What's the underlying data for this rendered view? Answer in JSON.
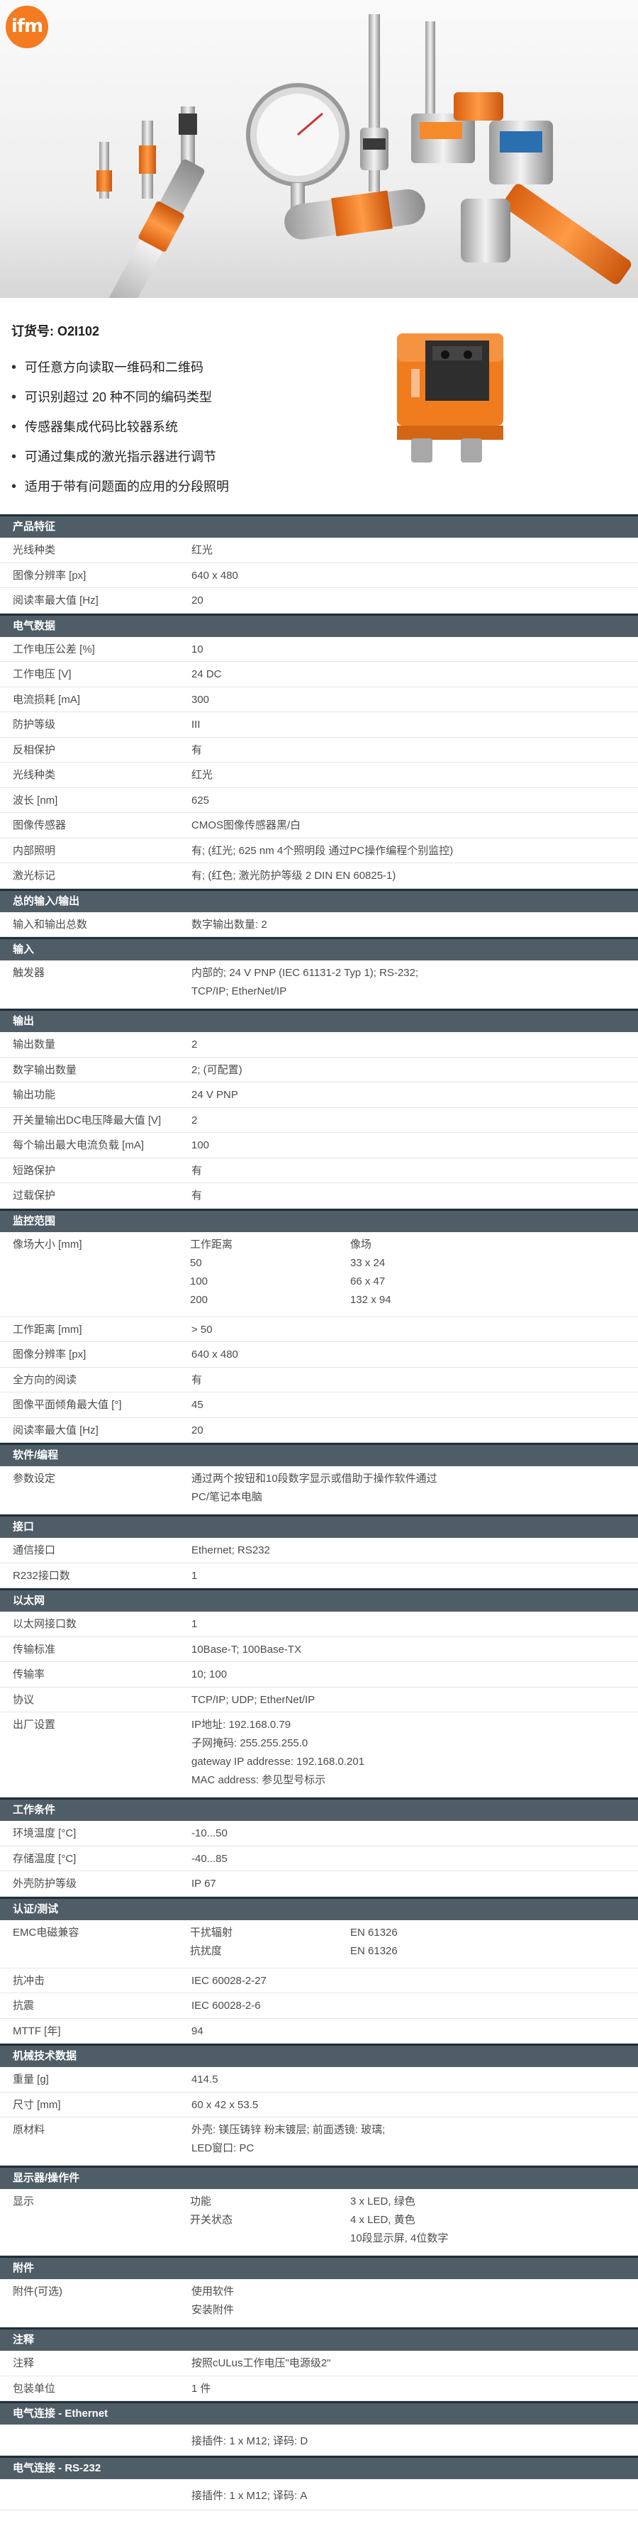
{
  "logo": {
    "text": "ifm"
  },
  "order": {
    "label": "订货号: O2I102"
  },
  "bullets": [
    "可任意方向读取一维码和二维码",
    "可识别超过 20 种不同的编码类型",
    "传感器集成代码比较器系统",
    "可通过集成的激光指示器进行调节",
    "适用于带有问题面的应用的分段照明"
  ],
  "colors": {
    "brand": "#f47b20",
    "section_header": "#4f5d66",
    "section_border": "#1f2f3a"
  },
  "sections": {
    "product": {
      "title": "产品特征",
      "rows": [
        {
          "k": "光线种类",
          "v": "红光"
        },
        {
          "k": "图像分辨率 [px]",
          "v": "640 x 480"
        },
        {
          "k": "阅读率最大值 [Hz]",
          "v": "20"
        }
      ]
    },
    "electrical": {
      "title": "电气数据",
      "rows": [
        {
          "k": "工作电压公差 [%]",
          "v": "10"
        },
        {
          "k": "工作电压 [V]",
          "v": "24 DC"
        },
        {
          "k": "电流损耗 [mA]",
          "v": "300"
        },
        {
          "k": "防护等级",
          "v": "III"
        },
        {
          "k": "反相保护",
          "v": "有"
        },
        {
          "k": "光线种类",
          "v": "红光"
        },
        {
          "k": "波长 [nm]",
          "v": "625"
        },
        {
          "k": "图像传感器",
          "v": "CMOS图像传感器黑/白"
        },
        {
          "k": "内部照明",
          "v": "有; (红光; 625 nm 4个照明段 通过PC操作编程个别监控)"
        },
        {
          "k": "激光标记",
          "v": "有; (红色; 激光防护等级 2 DIN EN 60825-1)"
        }
      ]
    },
    "io_total": {
      "title": "总的输入/输出",
      "rows": [
        {
          "k": "输入和输出总数",
          "v": "数字输出数量: 2"
        }
      ]
    },
    "inputs": {
      "title": "输入",
      "rows": [
        {
          "k": "触发器",
          "v1": "内部的; 24 V PNP (IEC 61131-2 Typ 1); RS-232;",
          "v2": "TCP/IP; EtherNet/IP"
        }
      ]
    },
    "outputs": {
      "title": "输出",
      "rows": [
        {
          "k": "输出数量",
          "v": "2"
        },
        {
          "k": "数字输出数量",
          "v": "2; (可配置)"
        },
        {
          "k": "输出功能",
          "v": "24 V PNP"
        },
        {
          "k": "开关量输出DC电压降最大值 [V]",
          "v": "2"
        },
        {
          "k": "每个输出最大电流负载 [mA]",
          "v": "100"
        },
        {
          "k": "短路保护",
          "v": "有"
        },
        {
          "k": "过载保护",
          "v": "有"
        }
      ]
    },
    "monitoring": {
      "title": "监控范围",
      "field_size": {
        "k": "像场大小 [mm]",
        "sub_head": "工作距离",
        "v_head": "像场",
        "rows": [
          {
            "sub": "50",
            "v": "33 x 24"
          },
          {
            "sub": "100",
            "v": "66 x 47"
          },
          {
            "sub": "200",
            "v": "132 x 94"
          }
        ]
      },
      "rows": [
        {
          "k": "工作距离 [mm]",
          "v": "> 50"
        },
        {
          "k": "图像分辨率 [px]",
          "v": "640 x 480"
        },
        {
          "k": "全方向的阅读",
          "v": "有"
        },
        {
          "k": "图像平面倾角最大值 [°]",
          "v": "45"
        },
        {
          "k": "阅读率最大值 [Hz]",
          "v": "20"
        }
      ]
    },
    "software": {
      "title": "软件/编程",
      "rows": [
        {
          "k": "参数设定",
          "v1": "通过两个按钮和10段数字显示或借助于操作软件通过",
          "v2": "PC/笔记本电脑"
        }
      ]
    },
    "interfaces": {
      "title": "接口",
      "rows": [
        {
          "k": "通信接口",
          "v": "Ethernet; RS232"
        },
        {
          "k": "R232接口数",
          "v": "1"
        }
      ]
    },
    "ethernet": {
      "title": "以太网",
      "rows": [
        {
          "k": "以太网接口数",
          "v": "1"
        },
        {
          "k": "传输标准",
          "v": "10Base-T; 100Base-TX"
        },
        {
          "k": "传输率",
          "v": "10; 100"
        },
        {
          "k": "协议",
          "v": "TCP/IP; UDP; EtherNet/IP"
        }
      ],
      "factory": {
        "k": "出厂设置",
        "lines": [
          "IP地址: 192.168.0.79",
          "子网掩码: 255.255.255.0",
          "gateway IP addresse: 192.168.0.201",
          "MAC address: 参见型号标示"
        ]
      }
    },
    "operating": {
      "title": "工作条件",
      "rows": [
        {
          "k": "环境温度 [°C]",
          "v": "-10...50"
        },
        {
          "k": "存储温度 [°C]",
          "v": "-40...85"
        },
        {
          "k": "外壳防护等级",
          "v": "IP 67"
        }
      ]
    },
    "approvals": {
      "title": "认证/测试",
      "emc": {
        "k": "EMC电磁兼容",
        "rows": [
          {
            "sub": "干扰辐射",
            "v": "EN 61326"
          },
          {
            "sub": "抗扰度",
            "v": "EN 61326"
          }
        ]
      },
      "rows": [
        {
          "k": "抗冲击",
          "v": "IEC 60028-2-27"
        },
        {
          "k": "抗震",
          "v": "IEC 60028-2-6"
        },
        {
          "k": "MTTF [年]",
          "v": "94"
        }
      ]
    },
    "mechanical": {
      "title": "机械技术数据",
      "rows": [
        {
          "k": "重量 [g]",
          "v": "414.5"
        },
        {
          "k": "尺寸 [mm]",
          "v": "60 x 42 x 53.5"
        },
        {
          "k": "原材料",
          "v1": "外壳: 镁压铸锌 粉末镀层; 前面透镜: 玻璃;",
          "v2": "LED窗口: PC"
        }
      ]
    },
    "display": {
      "title": "显示器/操作件",
      "disp": {
        "k": "显示",
        "rows": [
          {
            "sub": "功能",
            "v": "3 x LED, 绿色"
          },
          {
            "sub": "开关状态",
            "v": "4 x LED, 黄色"
          },
          {
            "sub": "",
            "v": "10段显示屏, 4位数字"
          }
        ]
      }
    },
    "accessories": {
      "title": "附件",
      "acc": {
        "k": "附件(可选)",
        "lines": [
          "使用软件",
          "安装附件"
        ]
      }
    },
    "remarks": {
      "title": "注释",
      "rows": [
        {
          "k": "注释",
          "v": "按照cULus工作电压\"电源级2\""
        },
        {
          "k": "包装单位",
          "v": "1 件"
        }
      ]
    },
    "conn_eth": {
      "title": "电气连接 - Ethernet",
      "rows": [
        {
          "k": "",
          "v": "接插件: 1 x M12; 译码: D"
        }
      ]
    },
    "conn_rs232": {
      "title": "电气连接 - RS-232",
      "rows": [
        {
          "k": "",
          "v": "接插件: 1 x M12; 译码: A"
        }
      ]
    }
  }
}
